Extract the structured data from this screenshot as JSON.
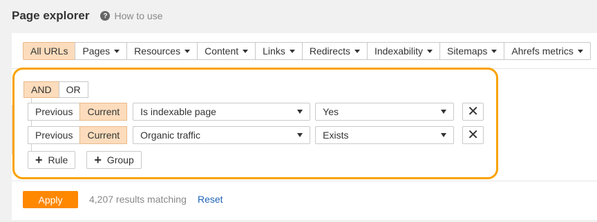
{
  "header": {
    "title": "Page explorer",
    "help_icon": "?",
    "how_to_use": "How to use"
  },
  "tabs": [
    {
      "label": "All URLs",
      "active": true,
      "dropdown": false
    },
    {
      "label": "Pages",
      "dropdown": true
    },
    {
      "label": "Resources",
      "dropdown": true
    },
    {
      "label": "Content",
      "dropdown": true
    },
    {
      "label": "Links",
      "dropdown": true
    },
    {
      "label": "Redirects",
      "dropdown": true
    },
    {
      "label": "Indexability",
      "dropdown": true
    },
    {
      "label": "Sitemaps",
      "dropdown": true
    },
    {
      "label": "Ahrefs metrics",
      "dropdown": true
    }
  ],
  "logic": {
    "and_label": "AND",
    "or_label": "OR",
    "selected": "AND"
  },
  "rules": [
    {
      "previous_label": "Previous",
      "current_label": "Current",
      "selected_period": "Current",
      "field": "Is indexable page",
      "value": "Yes",
      "remove_icon": "✕"
    },
    {
      "previous_label": "Previous",
      "current_label": "Current",
      "selected_period": "Current",
      "field": "Organic traffic",
      "value": "Exists",
      "remove_icon": "✕"
    }
  ],
  "actions": {
    "add_rule_label": "Rule",
    "add_group_label": "Group",
    "plus_icon": "+"
  },
  "footer": {
    "apply_label": "Apply",
    "results_text": "4,207 results matching",
    "reset_label": "Reset"
  },
  "colors": {
    "accent": "#ff8800",
    "highlight_border": "#f9a200",
    "active_segment": "#fcdcbc",
    "link": "#1d63b8"
  }
}
